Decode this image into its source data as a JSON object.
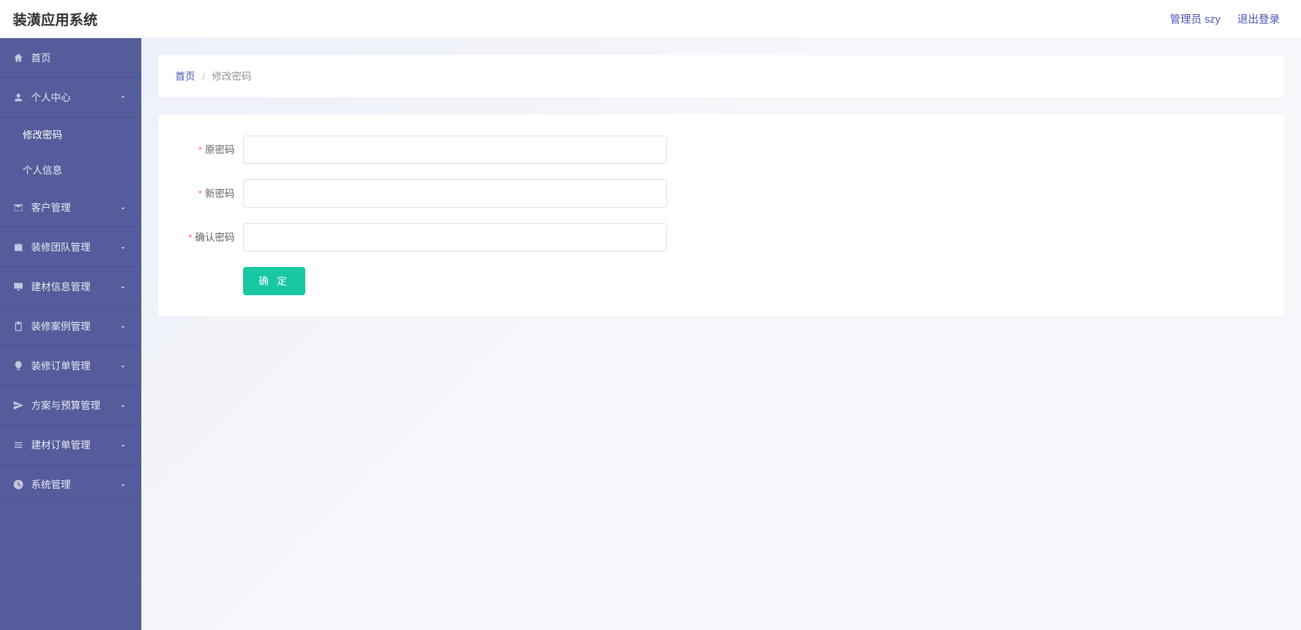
{
  "header": {
    "title": "装潢应用系统",
    "admin": "管理员 szy",
    "logout": "退出登录"
  },
  "sidebar": {
    "items": [
      {
        "label": "首页",
        "icon": "home",
        "expandable": false
      },
      {
        "label": "个人中心",
        "icon": "user",
        "expandable": true,
        "expanded": true,
        "children": [
          {
            "label": "修改密码",
            "active": true
          },
          {
            "label": "个人信息",
            "active": false
          }
        ]
      },
      {
        "label": "客户管理",
        "icon": "mail",
        "expandable": true,
        "expanded": false
      },
      {
        "label": "装修团队管理",
        "icon": "briefcase",
        "expandable": true,
        "expanded": false
      },
      {
        "label": "建材信息管理",
        "icon": "display",
        "expandable": true,
        "expanded": false
      },
      {
        "label": "装修案例管理",
        "icon": "clipboard",
        "expandable": true,
        "expanded": false
      },
      {
        "label": "装修订单管理",
        "icon": "bulb",
        "expandable": true,
        "expanded": false
      },
      {
        "label": "方案与预算管理",
        "icon": "send",
        "expandable": true,
        "expanded": false
      },
      {
        "label": "建材订单管理",
        "icon": "list",
        "expandable": true,
        "expanded": false
      },
      {
        "label": "系统管理",
        "icon": "clock",
        "expandable": true,
        "expanded": false
      }
    ]
  },
  "breadcrumb": {
    "home": "首页",
    "sep": "/",
    "current": "修改密码"
  },
  "form": {
    "fields": [
      {
        "label": "原密码",
        "required": true
      },
      {
        "label": "新密码",
        "required": true
      },
      {
        "label": "确认密码",
        "required": true
      }
    ],
    "submit": "确 定"
  },
  "colors": {
    "sidebar": "#545c9b",
    "accent": "#4a52b3",
    "submit": "#17c8a3",
    "required": "#f56c6c"
  }
}
